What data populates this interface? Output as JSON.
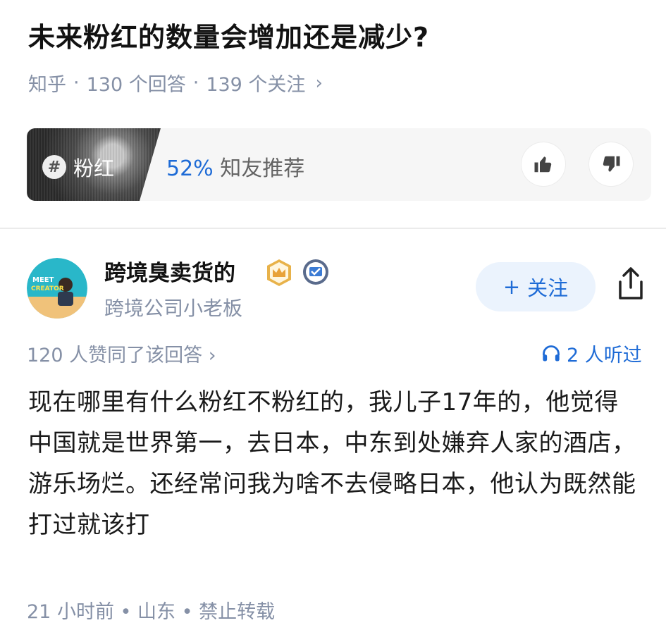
{
  "question": {
    "title": "未来粉红的数量会增加还是减少?",
    "meta": {
      "source": "知乎",
      "answers": "130 个回答",
      "followers": "139 个关注",
      "chevron": "›"
    }
  },
  "topic_card": {
    "tag": "粉红",
    "hash_icon": "hash-icon",
    "recommend_pct": "52%",
    "recommend_text": "知友推荐",
    "vote_up_icon": "thumbs-up-icon",
    "vote_down_icon": "thumbs-down-icon"
  },
  "answer": {
    "author": "跨境臭卖货的",
    "author_subtitle": "跨境公司小老板",
    "follow_label": "关注",
    "follow_prefix": "+",
    "likes": "120 人赞同了该回答 ›",
    "listeners": "2 人听过",
    "content": "现在哪里有什么粉红不粉红的，我儿子17年的，他觉得中国就是世界第一，去日本，中东到处嫌弃人家的酒店，游乐场烂。还经常问我为啥不去侵略日本，他认为既然能打过就该打",
    "footer": "21 小时前 • 山东 • 禁止转载",
    "avatar_text": "MEET CREATOR"
  },
  "colors": {
    "accent": "#1e6bd6",
    "muted": "#8590a6",
    "title": "#121212"
  }
}
